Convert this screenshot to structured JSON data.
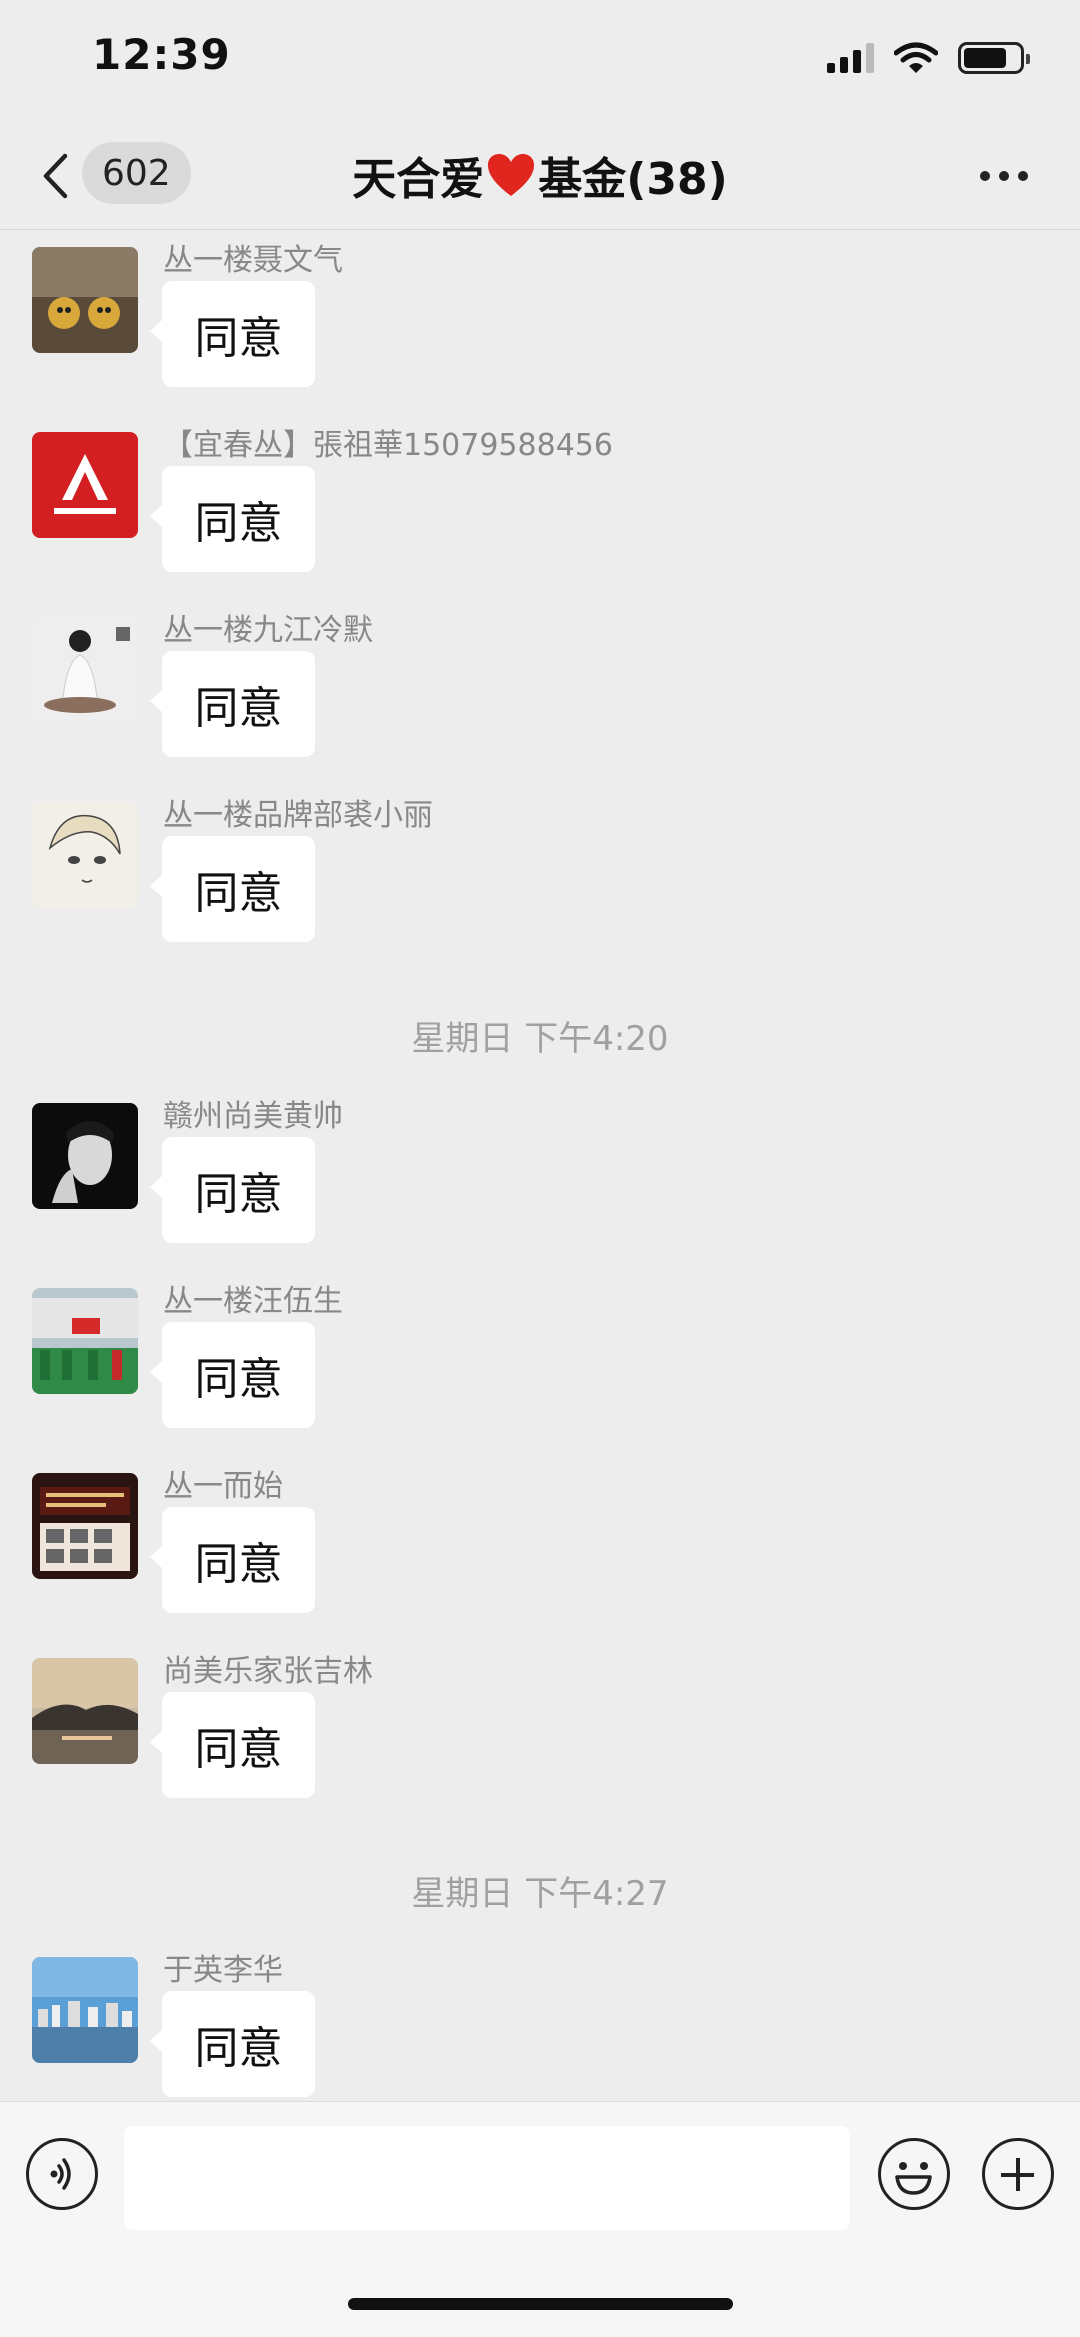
{
  "status_bar": {
    "time": "12:39"
  },
  "nav": {
    "unread_count": "602",
    "title_prefix": "天合爱",
    "title_suffix": "基金(38)"
  },
  "messages": [
    {
      "sender": "丛一楼聂文气",
      "text": "同意"
    },
    {
      "sender": "【宜春丛】張祖華15079588456",
      "text": "同意"
    },
    {
      "sender": "丛一楼九江冷默",
      "text": "同意"
    },
    {
      "sender": "丛一楼品牌部裘小丽",
      "text": "同意"
    },
    {
      "sender": "赣州尚美黄帅",
      "text": "同意"
    },
    {
      "sender": "丛一楼汪伍生",
      "text": "同意"
    },
    {
      "sender": "丛一而始",
      "text": "同意"
    },
    {
      "sender": "尚美乐家张吉林",
      "text": "同意"
    },
    {
      "sender": "于英李华",
      "text": "同意"
    }
  ],
  "timestamps": [
    "星期日 下午4:20",
    "星期日 下午4:27"
  ],
  "input": {
    "value": ""
  },
  "colors": {
    "background": "#ededed",
    "bubble": "#ffffff",
    "timestamp": "#a0a0a0",
    "heart": "#e0261f"
  }
}
